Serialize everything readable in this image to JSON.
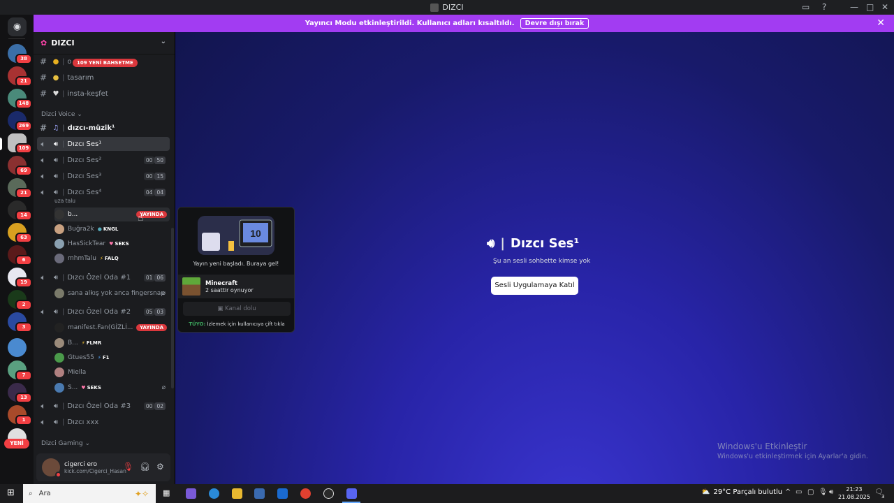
{
  "window": {
    "title": "DIZCI"
  },
  "banner": {
    "text": "Yayıncı Modu etkinleştirildi. Kullanıcı adları kısaltıldı.",
    "button": "Devre dışı bırak"
  },
  "rail": {
    "badges": [
      "38",
      "21",
      "148",
      "269",
      "109",
      "69",
      "21",
      "14",
      "63",
      "6",
      "19",
      "2",
      "3",
      "7",
      "13",
      "1"
    ],
    "new_label": "YENİ"
  },
  "server": {
    "name": "DIZCI"
  },
  "mention_pill": "109 YENİ BAHSETME",
  "channels_top": [
    {
      "name": "o"
    },
    {
      "name": "tasarım"
    },
    {
      "name": "insta-keşfet"
    }
  ],
  "category_voice": "Dizci Voice",
  "category_gaming": "Dizci Gaming",
  "music_channel": "dızcı-müzik¹",
  "voice_channels": [
    {
      "name": "Dızcı Ses¹"
    },
    {
      "name": "Dızcı Ses²",
      "a": "00",
      "b": "50"
    },
    {
      "name": "Dızcı Ses³",
      "a": "00",
      "b": "15"
    },
    {
      "name": "Dızcı Ses⁴",
      "a": "04",
      "b": "04"
    }
  ],
  "ses4_note": "uza talu",
  "ses4_users": [
    {
      "name": "b...",
      "tag": "",
      "live": "YAYINDA"
    },
    {
      "name": "Buğra2k",
      "tag": "KNGL"
    },
    {
      "name": "HasSickTear",
      "tag": "SEKS"
    },
    {
      "name": "mhmTalu",
      "tag": "FALQ"
    }
  ],
  "oda1": {
    "name": "Dızcı Özel Oda #1",
    "a": "01",
    "b": "06"
  },
  "oda1_users": [
    {
      "name": "sana alkış yok anca fingersnap"
    }
  ],
  "oda2": {
    "name": "Dızcı Özel Oda #2",
    "a": "05",
    "b": "03"
  },
  "oda2_users": [
    {
      "name": "manifest.Fan(GİZLİ...",
      "live": "YAYINDA"
    },
    {
      "name": "B...",
      "tag": "FLMR"
    },
    {
      "name": "Gtues55",
      "tag": "F1"
    },
    {
      "name": "Miella"
    },
    {
      "name": "S...",
      "tag": "SEKS"
    }
  ],
  "oda3": {
    "name": "Dızcı Özel Oda #3",
    "a": "00",
    "b": "02"
  },
  "xxx": {
    "name": "Dızcı xxx"
  },
  "user_panel": {
    "name": "cigerci ero",
    "sub": "kick.com/Cigerci_Hasan"
  },
  "popup": {
    "message": "Yayın yeni başladı. Buraya gel!",
    "game": "Minecraft",
    "game_time": "2 saattir oynuyor",
    "full": "Kanal dolu",
    "tip_prefix": "TÜYO:",
    "tip": "İzlemek için kullanıcıya çift tıkla",
    "screen_num": "10"
  },
  "main": {
    "title": "Dızcı Ses¹",
    "subtitle": "Şu an sesli sohbette kimse yok",
    "join": "Sesli Uygulamaya Katıl"
  },
  "watermark": {
    "line1": "Windows'u Etkinleştir",
    "line2": "Windows'u etkinleştirmek için Ayarlar'a gidin."
  },
  "taskbar": {
    "search": "Ara",
    "weather": "29°C  Parçalı bulutlu",
    "time": "21:23",
    "date": "21.08.2025",
    "notif": "3"
  },
  "colors": {
    "banner": "#a23cf2",
    "live": "#da373c",
    "badge": "#f23f43"
  }
}
